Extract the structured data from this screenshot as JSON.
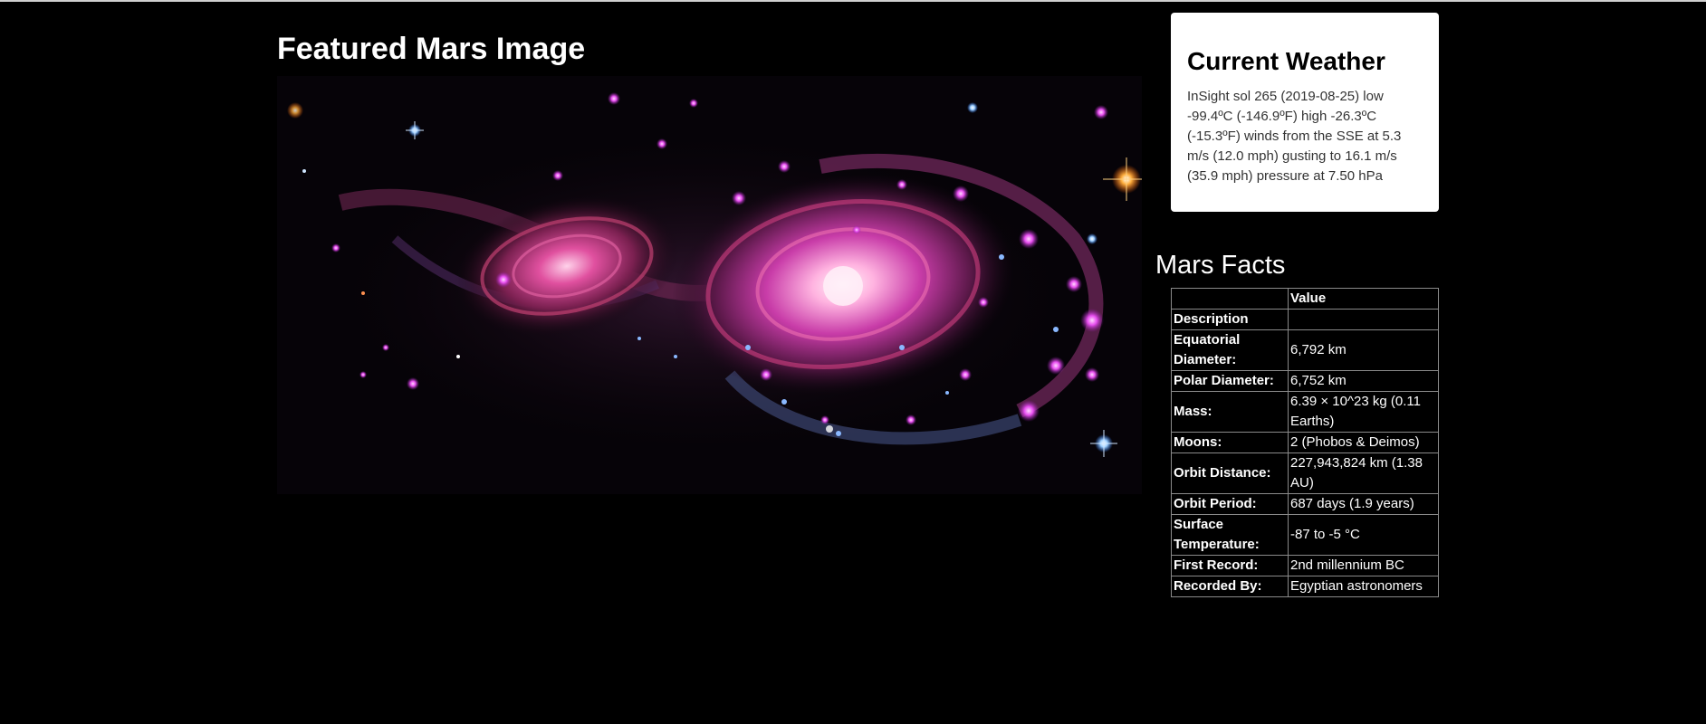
{
  "featured": {
    "title": "Featured Mars Image"
  },
  "weather": {
    "title": "Current Weather",
    "text": "InSight sol 265 (2019-08-25) low -99.4ºC (-146.9ºF) high -26.3ºC (-15.3ºF) winds from the SSE at 5.3 m/s (12.0 mph) gusting to 16.1 m/s (35.9 mph) pressure at 7.50 hPa"
  },
  "facts": {
    "title": "Mars Facts",
    "header": [
      "",
      "Value"
    ],
    "rows": [
      {
        "key": "Description",
        "value": ""
      },
      {
        "key": "Equatorial Diameter:",
        "value": "6,792 km"
      },
      {
        "key": "Polar Diameter:",
        "value": "6,752 km"
      },
      {
        "key": "Mass:",
        "value": "6.39 × 10^23 kg (0.11 Earths)"
      },
      {
        "key": "Moons:",
        "value": "2 (Phobos & Deimos)"
      },
      {
        "key": "Orbit Distance:",
        "value": "227,943,824 km (1.38 AU)"
      },
      {
        "key": "Orbit Period:",
        "value": "687 days (1.9 years)"
      },
      {
        "key": "Surface Temperature:",
        "value": "-87 to -5 °C"
      },
      {
        "key": "First Record:",
        "value": "2nd millennium BC"
      },
      {
        "key": "Recorded By:",
        "value": "Egyptian astronomers"
      }
    ]
  },
  "colors": {
    "background": "#000000",
    "panel": "#ffffff",
    "table_border": "#8a8a8a"
  }
}
